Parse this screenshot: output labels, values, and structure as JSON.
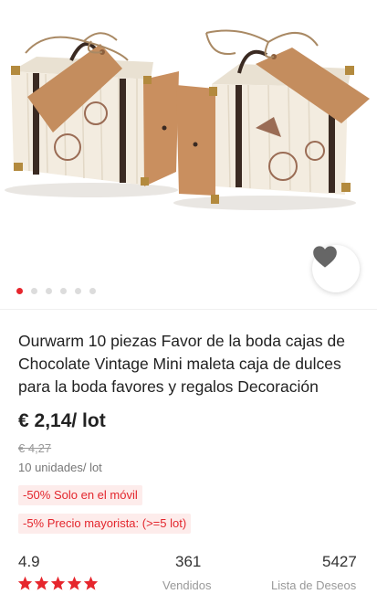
{
  "gallery": {
    "image_icon": "product-photo-two-suitcase-boxes",
    "wishlist_icon": "heart-icon",
    "dots_total": 6,
    "active_dot": 0
  },
  "product": {
    "title": "Ourwarm 10 piezas Favor de la boda cajas de Chocolate Vintage Mini maleta caja de dulces para la boda favores y regalos Decoración",
    "price": "€ 2,14/ lot",
    "original_price": "€ 4,27",
    "unit_info": "10 unidades/ lot"
  },
  "promos": [
    "-50% Solo en el móvil",
    "-5% Precio mayorista: (>=5 lot)"
  ],
  "stats": {
    "rating": "4.9",
    "stars": 5,
    "sold_count": "361",
    "sold_label": "Vendidos",
    "wishlist_count": "5427",
    "wishlist_label": "Lista de Deseos"
  },
  "colors": {
    "accent": "#e6262d",
    "promo_bg": "#fdeceb",
    "kraft": "#c98f5f",
    "box_cream": "#f3ece0"
  }
}
